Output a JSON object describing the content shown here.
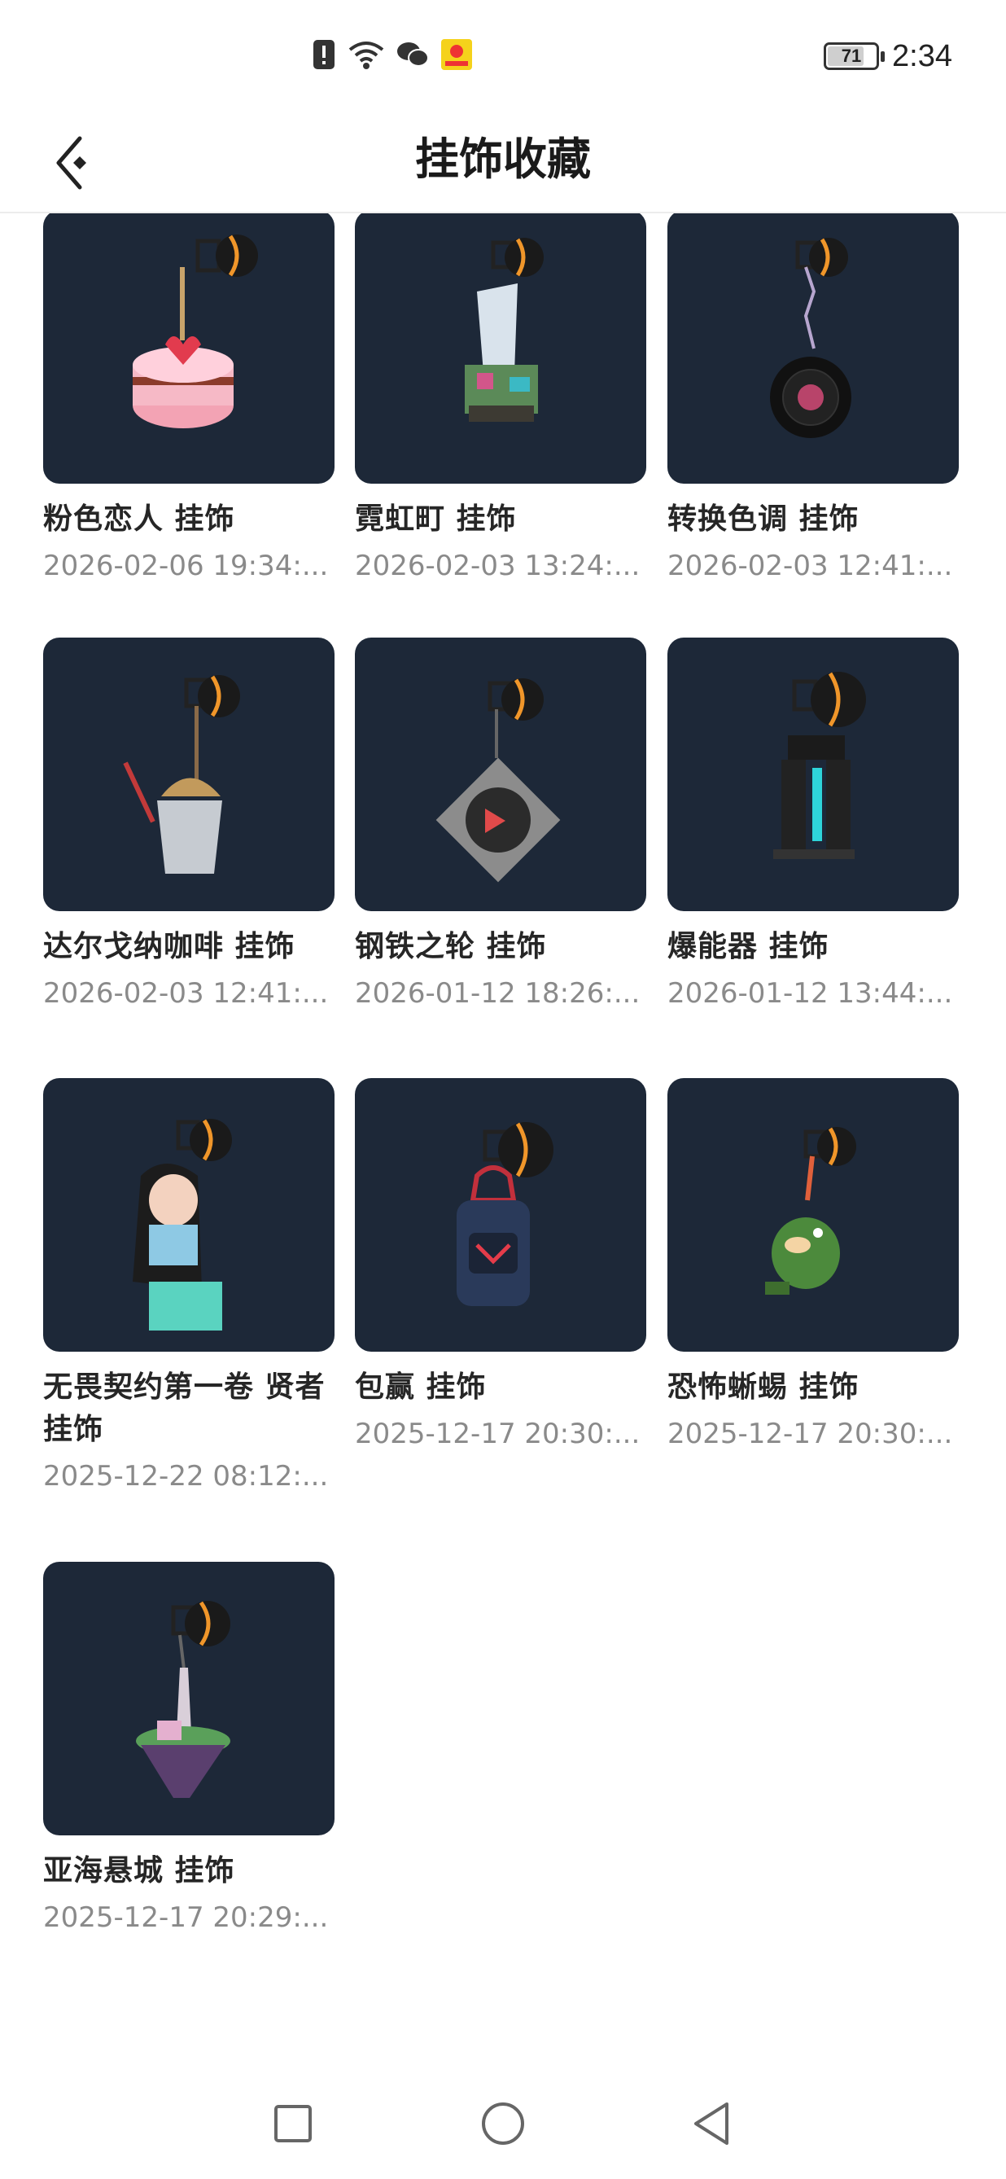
{
  "status_bar": {
    "time": "2:34",
    "battery_level": "71",
    "battery_fraction": 0.71,
    "icons": [
      "alert-icon",
      "wifi-icon",
      "wechat-icon",
      "app-notification-icon"
    ]
  },
  "header": {
    "title": "挂饰收藏",
    "back_icon": "back-arrow-icon"
  },
  "colors": {
    "thumb_bg": "#1d2838",
    "accent_orange": "#f0962a"
  },
  "items": [
    {
      "name": "粉色恋人 挂饰",
      "date": "2026-02-06 19:34:..."
    },
    {
      "name": "霓虹町 挂饰",
      "date": "2026-02-03 13:24:..."
    },
    {
      "name": "转换色调 挂饰",
      "date": "2026-02-03 12:41:..."
    },
    {
      "name": "达尔戈纳咖啡 挂饰",
      "date": "2026-02-03 12:41:..."
    },
    {
      "name": "钢铁之轮 挂饰",
      "date": "2026-01-12 18:26:..."
    },
    {
      "name": "爆能器 挂饰",
      "date": "2026-01-12 13:44:..."
    },
    {
      "name": "无畏契约第一卷 贤者 挂饰",
      "date": "2025-12-22 08:12:..."
    },
    {
      "name": "包赢 挂饰",
      "date": "2025-12-17 20:30:..."
    },
    {
      "name": "恐怖蜥蜴 挂饰",
      "date": "2025-12-17 20:30:..."
    },
    {
      "name": "亚海悬城 挂饰",
      "date": "2025-12-17 20:29:..."
    }
  ],
  "nav": {
    "recents_icon": "square-icon",
    "home_icon": "circle-icon",
    "back_icon": "triangle-back-icon"
  }
}
